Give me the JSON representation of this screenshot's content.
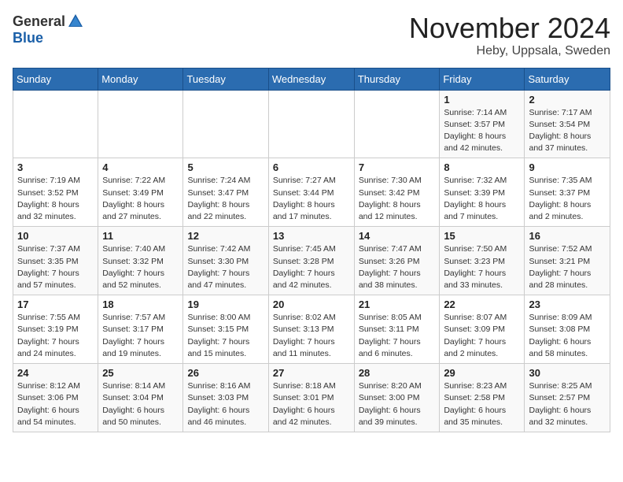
{
  "header": {
    "logo_general": "General",
    "logo_blue": "Blue",
    "month_title": "November 2024",
    "location": "Heby, Uppsala, Sweden"
  },
  "calendar": {
    "weekdays": [
      "Sunday",
      "Monday",
      "Tuesday",
      "Wednesday",
      "Thursday",
      "Friday",
      "Saturday"
    ],
    "weeks": [
      [
        {
          "day": "",
          "info": ""
        },
        {
          "day": "",
          "info": ""
        },
        {
          "day": "",
          "info": ""
        },
        {
          "day": "",
          "info": ""
        },
        {
          "day": "",
          "info": ""
        },
        {
          "day": "1",
          "info": "Sunrise: 7:14 AM\nSunset: 3:57 PM\nDaylight: 8 hours and 42 minutes."
        },
        {
          "day": "2",
          "info": "Sunrise: 7:17 AM\nSunset: 3:54 PM\nDaylight: 8 hours and 37 minutes."
        }
      ],
      [
        {
          "day": "3",
          "info": "Sunrise: 7:19 AM\nSunset: 3:52 PM\nDaylight: 8 hours and 32 minutes."
        },
        {
          "day": "4",
          "info": "Sunrise: 7:22 AM\nSunset: 3:49 PM\nDaylight: 8 hours and 27 minutes."
        },
        {
          "day": "5",
          "info": "Sunrise: 7:24 AM\nSunset: 3:47 PM\nDaylight: 8 hours and 22 minutes."
        },
        {
          "day": "6",
          "info": "Sunrise: 7:27 AM\nSunset: 3:44 PM\nDaylight: 8 hours and 17 minutes."
        },
        {
          "day": "7",
          "info": "Sunrise: 7:30 AM\nSunset: 3:42 PM\nDaylight: 8 hours and 12 minutes."
        },
        {
          "day": "8",
          "info": "Sunrise: 7:32 AM\nSunset: 3:39 PM\nDaylight: 8 hours and 7 minutes."
        },
        {
          "day": "9",
          "info": "Sunrise: 7:35 AM\nSunset: 3:37 PM\nDaylight: 8 hours and 2 minutes."
        }
      ],
      [
        {
          "day": "10",
          "info": "Sunrise: 7:37 AM\nSunset: 3:35 PM\nDaylight: 7 hours and 57 minutes."
        },
        {
          "day": "11",
          "info": "Sunrise: 7:40 AM\nSunset: 3:32 PM\nDaylight: 7 hours and 52 minutes."
        },
        {
          "day": "12",
          "info": "Sunrise: 7:42 AM\nSunset: 3:30 PM\nDaylight: 7 hours and 47 minutes."
        },
        {
          "day": "13",
          "info": "Sunrise: 7:45 AM\nSunset: 3:28 PM\nDaylight: 7 hours and 42 minutes."
        },
        {
          "day": "14",
          "info": "Sunrise: 7:47 AM\nSunset: 3:26 PM\nDaylight: 7 hours and 38 minutes."
        },
        {
          "day": "15",
          "info": "Sunrise: 7:50 AM\nSunset: 3:23 PM\nDaylight: 7 hours and 33 minutes."
        },
        {
          "day": "16",
          "info": "Sunrise: 7:52 AM\nSunset: 3:21 PM\nDaylight: 7 hours and 28 minutes."
        }
      ],
      [
        {
          "day": "17",
          "info": "Sunrise: 7:55 AM\nSunset: 3:19 PM\nDaylight: 7 hours and 24 minutes."
        },
        {
          "day": "18",
          "info": "Sunrise: 7:57 AM\nSunset: 3:17 PM\nDaylight: 7 hours and 19 minutes."
        },
        {
          "day": "19",
          "info": "Sunrise: 8:00 AM\nSunset: 3:15 PM\nDaylight: 7 hours and 15 minutes."
        },
        {
          "day": "20",
          "info": "Sunrise: 8:02 AM\nSunset: 3:13 PM\nDaylight: 7 hours and 11 minutes."
        },
        {
          "day": "21",
          "info": "Sunrise: 8:05 AM\nSunset: 3:11 PM\nDaylight: 7 hours and 6 minutes."
        },
        {
          "day": "22",
          "info": "Sunrise: 8:07 AM\nSunset: 3:09 PM\nDaylight: 7 hours and 2 minutes."
        },
        {
          "day": "23",
          "info": "Sunrise: 8:09 AM\nSunset: 3:08 PM\nDaylight: 6 hours and 58 minutes."
        }
      ],
      [
        {
          "day": "24",
          "info": "Sunrise: 8:12 AM\nSunset: 3:06 PM\nDaylight: 6 hours and 54 minutes."
        },
        {
          "day": "25",
          "info": "Sunrise: 8:14 AM\nSunset: 3:04 PM\nDaylight: 6 hours and 50 minutes."
        },
        {
          "day": "26",
          "info": "Sunrise: 8:16 AM\nSunset: 3:03 PM\nDaylight: 6 hours and 46 minutes."
        },
        {
          "day": "27",
          "info": "Sunrise: 8:18 AM\nSunset: 3:01 PM\nDaylight: 6 hours and 42 minutes."
        },
        {
          "day": "28",
          "info": "Sunrise: 8:20 AM\nSunset: 3:00 PM\nDaylight: 6 hours and 39 minutes."
        },
        {
          "day": "29",
          "info": "Sunrise: 8:23 AM\nSunset: 2:58 PM\nDaylight: 6 hours and 35 minutes."
        },
        {
          "day": "30",
          "info": "Sunrise: 8:25 AM\nSunset: 2:57 PM\nDaylight: 6 hours and 32 minutes."
        }
      ]
    ]
  }
}
